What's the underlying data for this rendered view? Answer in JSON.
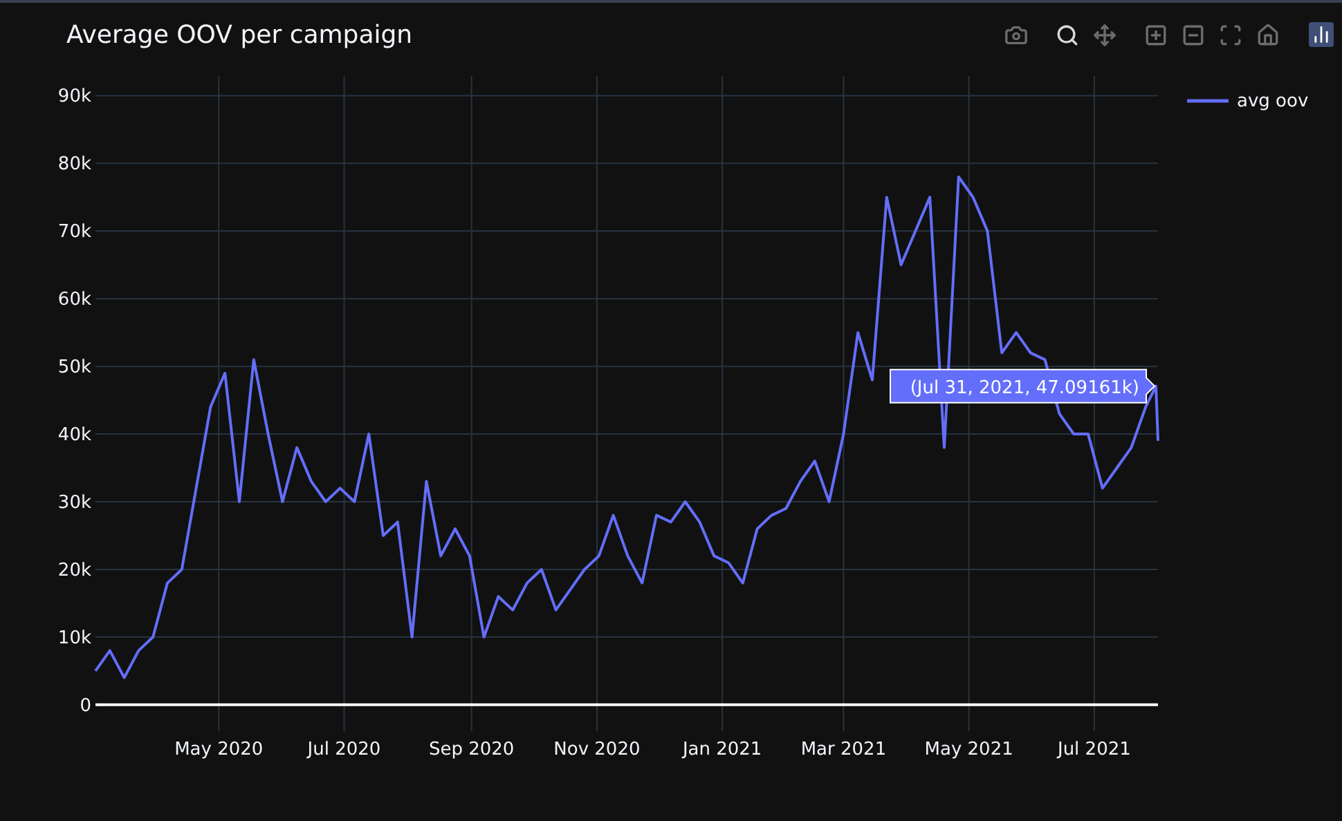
{
  "modebar": [
    {
      "kind": "camera",
      "selected": false
    },
    {
      "kind": "zoom",
      "selected": true
    },
    {
      "kind": "pan",
      "selected": false
    },
    {
      "kind": "zoom_in",
      "selected": false
    },
    {
      "kind": "zoom_out",
      "selected": false
    },
    {
      "kind": "autoscale",
      "selected": false
    },
    {
      "kind": "home",
      "selected": false
    },
    {
      "kind": "logo",
      "selected": false
    }
  ],
  "chart_data": {
    "type": "line",
    "title": "Average OOV per campaign",
    "grid": true,
    "x": [
      "2020-03-02",
      "2020-03-09",
      "2020-03-16",
      "2020-03-23",
      "2020-03-30",
      "2020-04-06",
      "2020-04-13",
      "2020-04-20",
      "2020-04-27",
      "2020-05-04",
      "2020-05-11",
      "2020-05-18",
      "2020-05-25",
      "2020-06-01",
      "2020-06-08",
      "2020-06-15",
      "2020-06-22",
      "2020-06-29",
      "2020-07-06",
      "2020-07-13",
      "2020-07-20",
      "2020-07-27",
      "2020-08-03",
      "2020-08-10",
      "2020-08-17",
      "2020-08-24",
      "2020-08-31",
      "2020-09-07",
      "2020-09-14",
      "2020-09-21",
      "2020-09-28",
      "2020-10-05",
      "2020-10-12",
      "2020-10-19",
      "2020-10-26",
      "2020-11-02",
      "2020-11-09",
      "2020-11-16",
      "2020-11-23",
      "2020-11-30",
      "2020-12-07",
      "2020-12-14",
      "2020-12-21",
      "2020-12-28",
      "2021-01-04",
      "2021-01-11",
      "2021-01-18",
      "2021-01-25",
      "2021-02-01",
      "2021-02-08",
      "2021-02-15",
      "2021-02-22",
      "2021-03-01",
      "2021-03-08",
      "2021-03-15",
      "2021-03-22",
      "2021-03-29",
      "2021-04-05",
      "2021-04-12",
      "2021-04-19",
      "2021-04-26",
      "2021-05-03",
      "2021-05-10",
      "2021-05-17",
      "2021-05-24",
      "2021-05-31",
      "2021-06-07",
      "2021-06-14",
      "2021-06-21",
      "2021-06-28",
      "2021-07-05",
      "2021-07-12",
      "2021-07-19",
      "2021-07-26",
      "2021-07-31",
      "2021-08-01"
    ],
    "series": [
      {
        "name": "avg oov",
        "color": "#636efa",
        "values": [
          5000,
          8000,
          4000,
          8000,
          10000,
          18000,
          20000,
          32000,
          44000,
          49000,
          30000,
          51000,
          40000,
          30000,
          38000,
          33000,
          30000,
          32000,
          30000,
          40000,
          25000,
          27000,
          10000,
          33000,
          22000,
          26000,
          22000,
          10000,
          16000,
          14000,
          18000,
          20000,
          14000,
          17000,
          20000,
          22000,
          28000,
          22000,
          18000,
          28000,
          27000,
          30000,
          27000,
          22000,
          21000,
          18000,
          26000,
          28000,
          29000,
          33000,
          36000,
          30000,
          40000,
          55000,
          48000,
          75000,
          65000,
          70000,
          75000,
          38000,
          78000,
          75000,
          70000,
          52000,
          55000,
          52000,
          51000,
          43000,
          40000,
          40000,
          32000,
          35000,
          38000,
          44000,
          47090,
          39000
        ]
      }
    ],
    "xlim": [
      "2020-03-02",
      "2021-08-01"
    ],
    "ylim": [
      -3900,
      92900
    ],
    "xticks": [
      {
        "value": "2020-05-01",
        "label": "May 2020"
      },
      {
        "value": "2020-07-01",
        "label": "Jul 2020"
      },
      {
        "value": "2020-09-01",
        "label": "Sep 2020"
      },
      {
        "value": "2020-11-01",
        "label": "Nov 2020"
      },
      {
        "value": "2021-01-01",
        "label": "Jan 2021"
      },
      {
        "value": "2021-03-01",
        "label": "Mar 2021"
      },
      {
        "value": "2021-05-01",
        "label": "May 2021"
      },
      {
        "value": "2021-07-01",
        "label": "Jul 2021"
      }
    ],
    "yticks": [
      {
        "value": 0,
        "label": "0"
      },
      {
        "value": 10000,
        "label": "10k"
      },
      {
        "value": 20000,
        "label": "20k"
      },
      {
        "value": 30000,
        "label": "30k"
      },
      {
        "value": 40000,
        "label": "40k"
      },
      {
        "value": 50000,
        "label": "50k"
      },
      {
        "value": 60000,
        "label": "60k"
      },
      {
        "value": 70000,
        "label": "70k"
      },
      {
        "value": 80000,
        "label": "80k"
      },
      {
        "value": 90000,
        "label": "90k"
      }
    ],
    "annotations": [
      {
        "x": "2021-07-31",
        "y": 47090,
        "text": "(Jul 31, 2021, 47.09161k)"
      }
    ]
  }
}
